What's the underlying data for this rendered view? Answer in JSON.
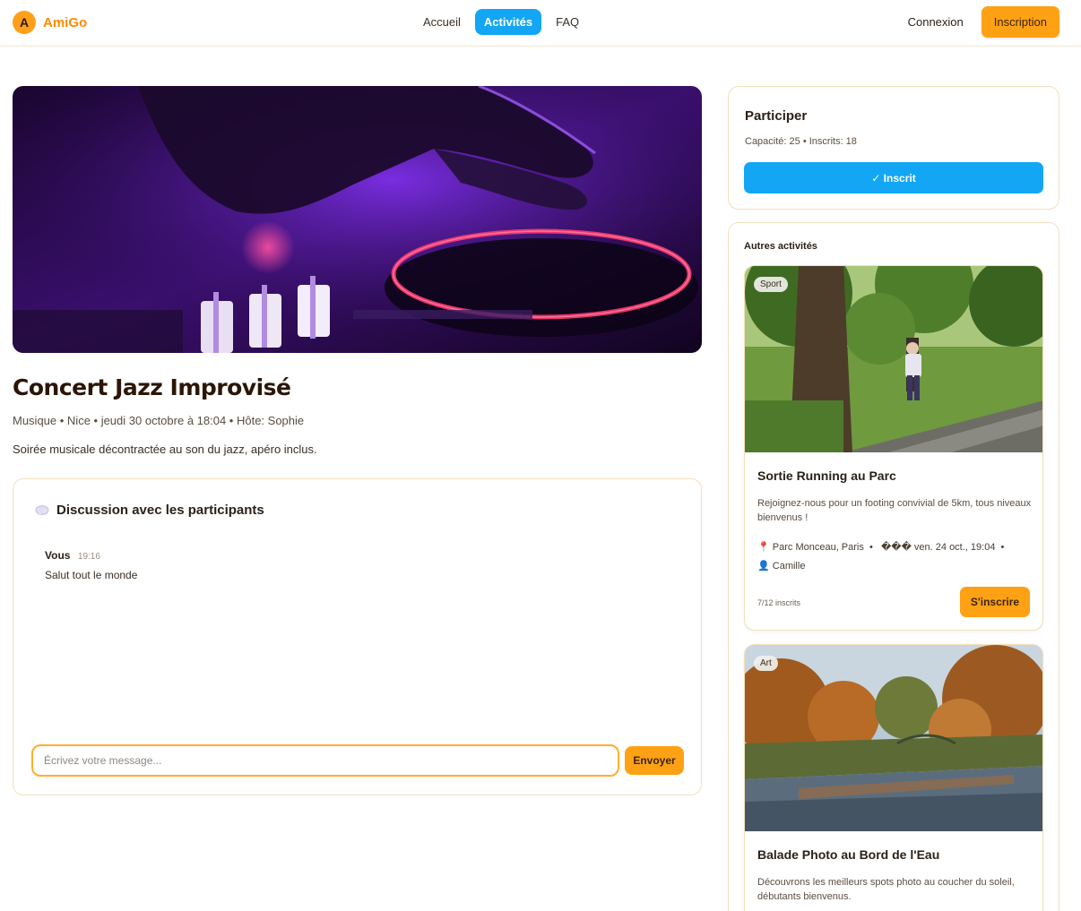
{
  "header": {
    "logo_letter": "A",
    "app_name": "AmiGo",
    "nav": [
      {
        "label": "Accueil",
        "active": false
      },
      {
        "label": "Activités",
        "active": true
      },
      {
        "label": "FAQ",
        "active": false
      }
    ],
    "login_label": "Connexion",
    "signup_label": "Inscription"
  },
  "event": {
    "title": "Concert Jazz Improvisé",
    "meta": "Musique • Nice • jeudi 30 octobre à 18:04 • Hôte: Sophie",
    "description": "Soirée musicale décontractée au son du jazz, apéro inclus."
  },
  "chat": {
    "title": "Discussion avec les participants",
    "messages": [
      {
        "author": "Vous",
        "time": "19:16",
        "text": "Salut tout le monde"
      }
    ],
    "input_placeholder": "Écrivez votre message...",
    "send_label": "Envoyer"
  },
  "join": {
    "title": "Participer",
    "capacity_text": "Capacité: 25 • Inscrits: 18",
    "button_label": "✓ Inscrit"
  },
  "others": {
    "title": "Autres activités",
    "items": [
      {
        "tag": "Sport",
        "title": "Sortie Running au Parc",
        "description": "Rejoignez-nous pour un footing convivial de 5km, tous niveaux bienvenus !",
        "location": "Parc Monceau, Paris",
        "date": "��� ven. 24 oct., 19:04",
        "host": "Camille",
        "count": "7/12 inscrits",
        "button_label": "S'inscrire"
      },
      {
        "tag": "Art",
        "title": "Balade Photo au Bord de l'Eau",
        "description": "Découvrons les meilleurs spots photo au coucher du soleil, débutants bienvenus."
      }
    ]
  },
  "colors": {
    "accent_orange": "#ffa114",
    "accent_blue": "#12a6f5",
    "border": "#f4dfbd"
  }
}
